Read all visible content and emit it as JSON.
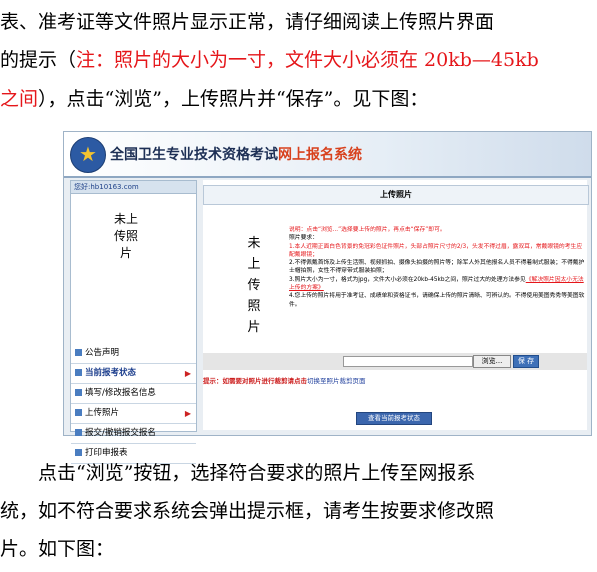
{
  "intro": {
    "line1": "表、准考证等文件照片显示正常，请仔细阅读上传照片界面",
    "line2_a": "的提示（",
    "line2_note": "注：照片的大小为一寸，文件大小必须在 20kb—45kb",
    "line3_note": "之间",
    "line3_b": "），点击“浏览”，上传照片并“保存”。见下图："
  },
  "screenshot": {
    "title": "全国卫生专业技术资格考试",
    "subtitle": "网上报名系统",
    "sidebar_top": "您好:hb10163.com",
    "sidebar_photo": "未上传照片",
    "menu": [
      {
        "label": "公告声明"
      },
      {
        "label": "当前报考状态"
      },
      {
        "label": "填写/修改报名信息"
      },
      {
        "label": "上传照片"
      },
      {
        "label": "报交/撤销报交报名"
      },
      {
        "label": "打印申报表"
      }
    ],
    "panel_header": "上传照片",
    "main_photo": "未上传照片",
    "notes": {
      "n0": "说明：点击“浏览...”选择要上传的照片，再点击“保存”即可。",
      "n1": "照片要求：",
      "n2": "1.本人近期正面白色背景的免冠彩色证件照片，头部占照片尺寸的2/3，头发不得过眉，露双耳，常戴眼镜的考生应配戴眼镜；",
      "n3": "2.不得佩戴首饰及上传生活照、视频抓拍、摄像头拍摄的照片等；除军人外其他报名人员不得着制式服装；不得戴护士帽拍照，女性不得穿带式服装拍照；",
      "n4": "3.照片大小为一寸，格式为jpg，文件大小必须在20kb-45kb之间，照片过大的处理方法参见",
      "n4_link": "《解决照片因太小无法上传的方案》",
      "n5": "4.您上传的照片将用于准考证、成绩单和资格证书，请确保上传的照片清晰、可辨认的。不得使用美图秀秀等美图软件。"
    },
    "browse_label": "浏览...",
    "save_label": "保 存",
    "tip_label": "提示：如需要对照片进行裁剪请点击",
    "tip_link": "切换至照片裁剪页面",
    "view_label": "查看当前报考状态"
  },
  "outro": {
    "line1": "点击“浏览”按钮，选择符合要求的照片上传至网报系",
    "line2": "统，如不符合要求系统会弹出提示框，请考生按要求修改照",
    "line3": "片。如下图："
  },
  "colors": {
    "accent_red": "#e5161a",
    "banner_blue": "#2c5aa3"
  }
}
